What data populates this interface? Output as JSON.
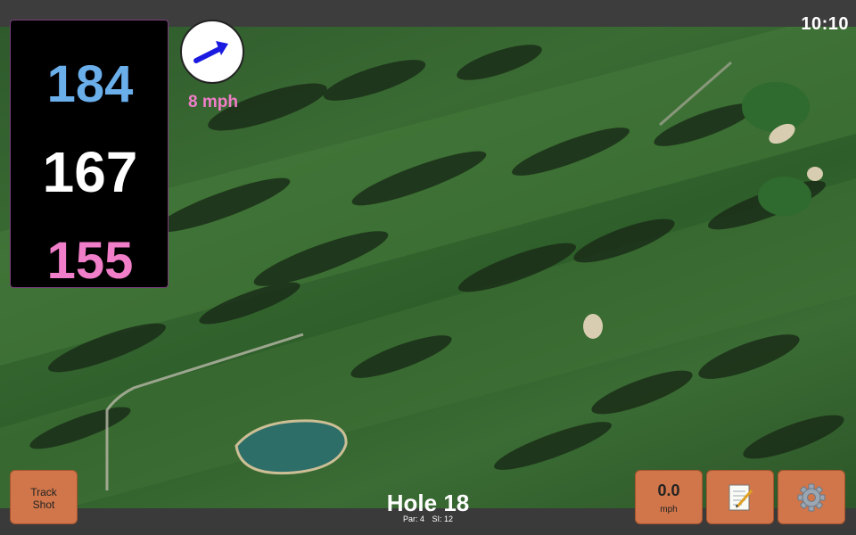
{
  "status": {
    "time": "10:10"
  },
  "distances": {
    "back": "184",
    "middle": "167",
    "front": "155",
    "colors": {
      "back": "#6aaeea",
      "middle": "#ffffff",
      "front": "#f07ec8"
    }
  },
  "wind": {
    "speed": "8 mph",
    "direction_icon": "arrow-right-up-icon"
  },
  "buttons": {
    "track_shot_line1": "Track",
    "track_shot_line2": "Shot",
    "speed_value": "0.0",
    "speed_unit": "mph",
    "notes_icon": "notepad-icon",
    "settings_icon": "gear-icon"
  },
  "hole": {
    "title": "Hole 18",
    "par": "Par: 4",
    "si": "SI: 12"
  },
  "colors": {
    "button_bg": "#d0764a",
    "panel_bg": "#000000",
    "bar_bg": "#3d3d3d"
  }
}
